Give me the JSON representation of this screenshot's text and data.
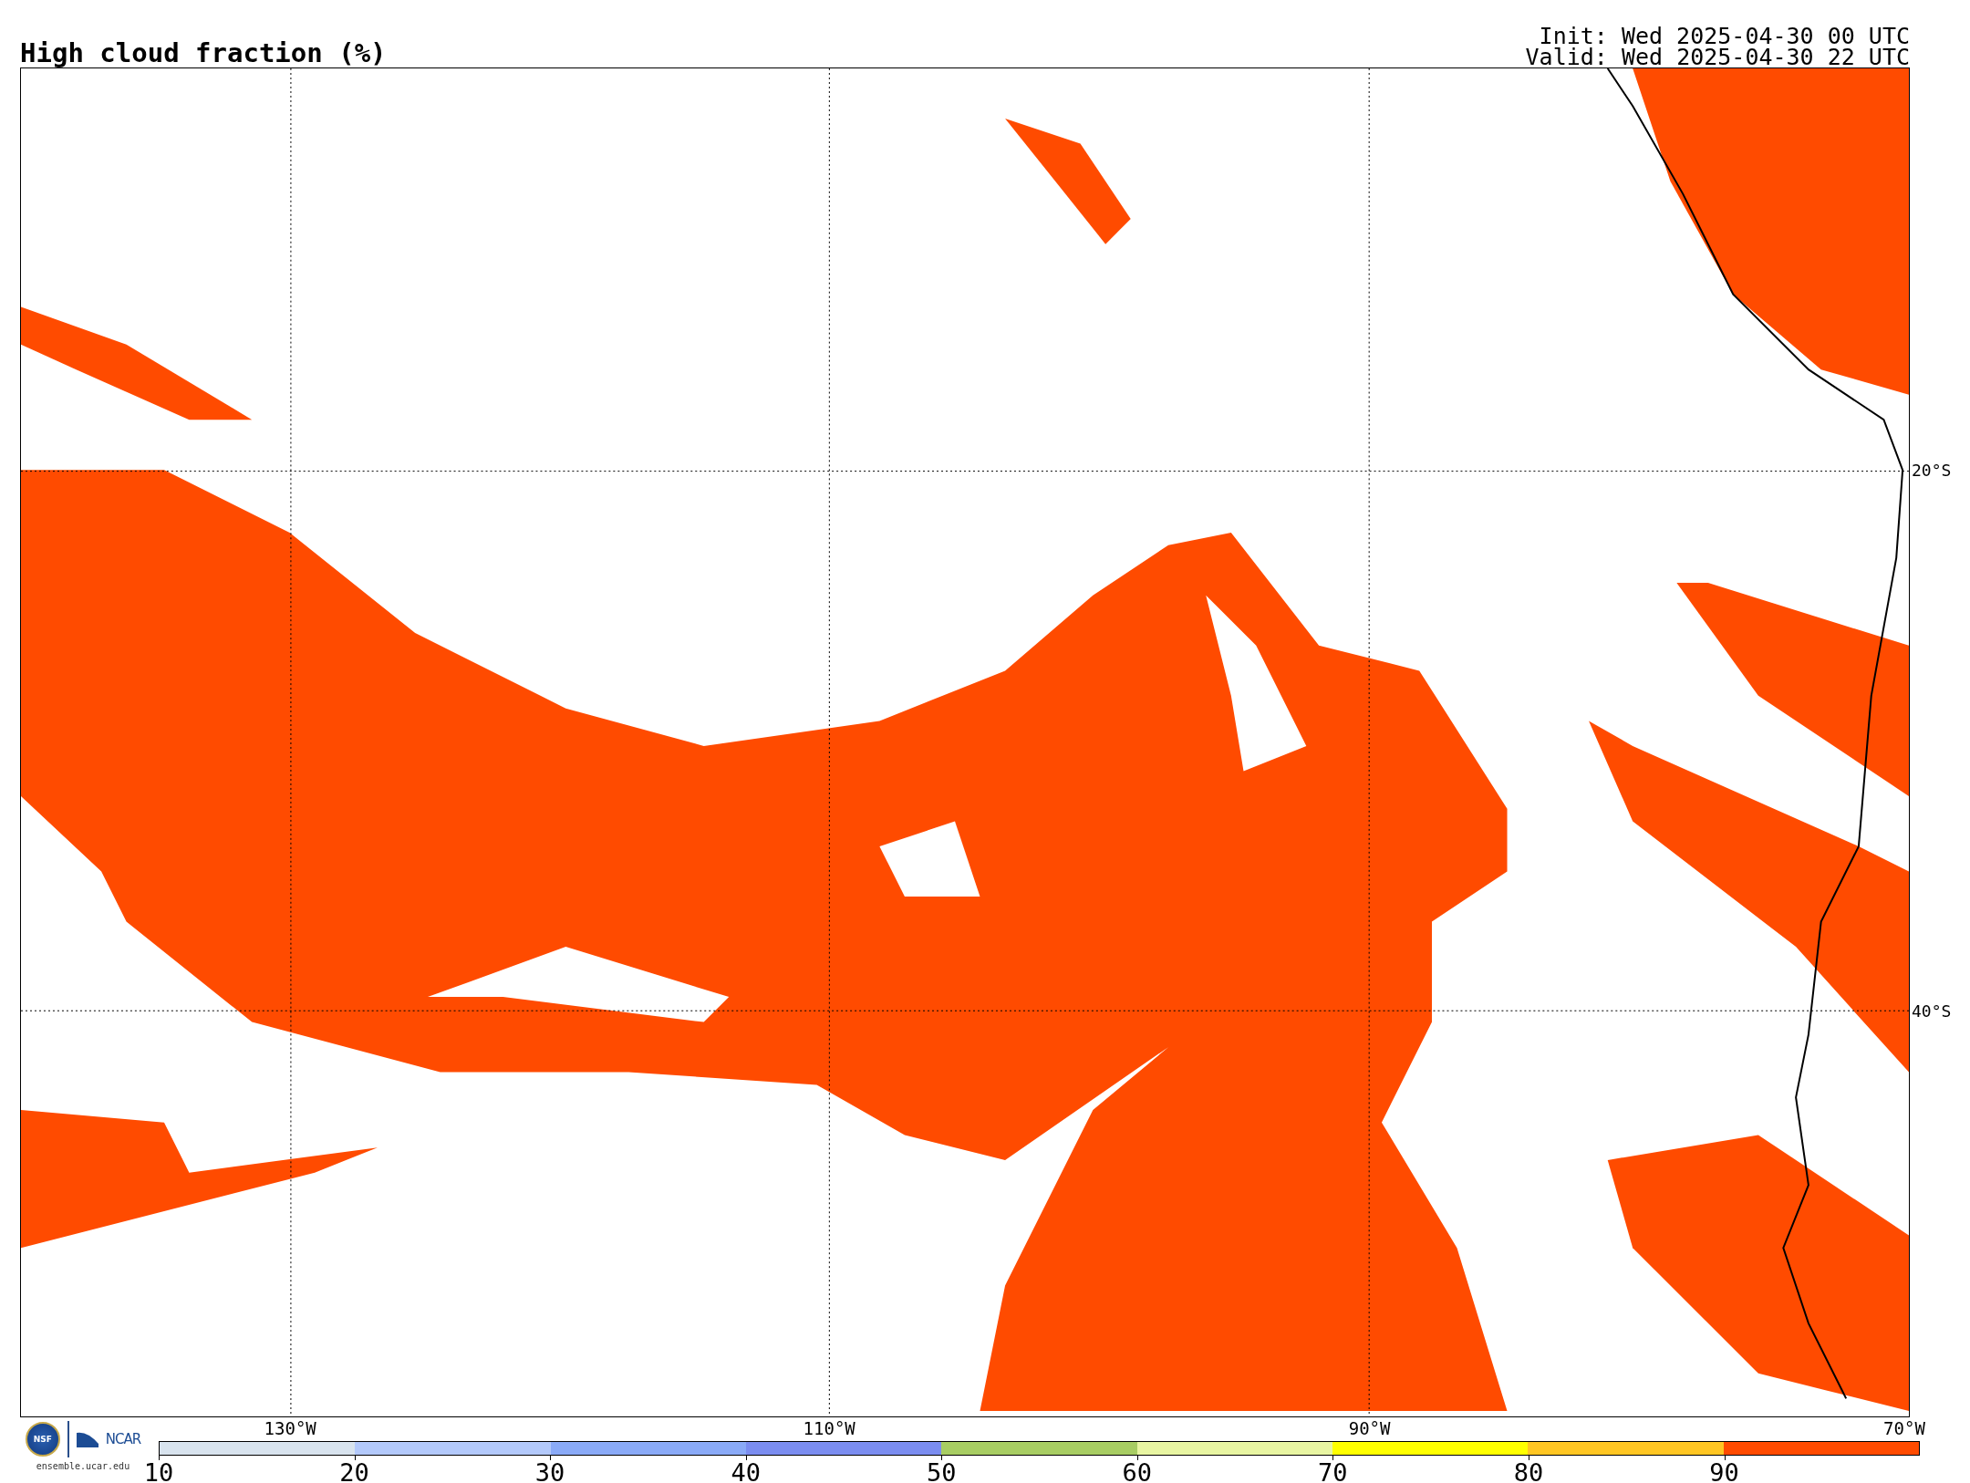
{
  "title": "High cloud fraction (%)",
  "times": [
    "Init: Wed 2025-04-30 00 UTC",
    "Valid: Wed 2025-04-30 22 UTC"
  ],
  "map": {
    "lat_labels": [
      "20°S",
      "40°S"
    ],
    "lon_labels": [
      "130°W",
      "110°W",
      "90°W",
      "70°W"
    ]
  },
  "logo": {
    "seal": "NSF",
    "name": "NCAR",
    "url": "ensemble.ucar.edu"
  },
  "colorbar": {
    "ticks": [
      "10",
      "20",
      "30",
      "40",
      "50",
      "60",
      "70",
      "80",
      "90"
    ],
    "bins": [
      {
        "color": "#d8e3ee"
      },
      {
        "color": "#b3c9fb"
      },
      {
        "color": "#8aaaf7"
      },
      {
        "color": "#7b8df0"
      },
      {
        "color": "#a8cd63"
      },
      {
        "color": "#e8f5a2"
      },
      {
        "color": "#ffff00"
      },
      {
        "color": "#ffc623"
      },
      {
        "color": "#ff4b00"
      }
    ]
  }
}
